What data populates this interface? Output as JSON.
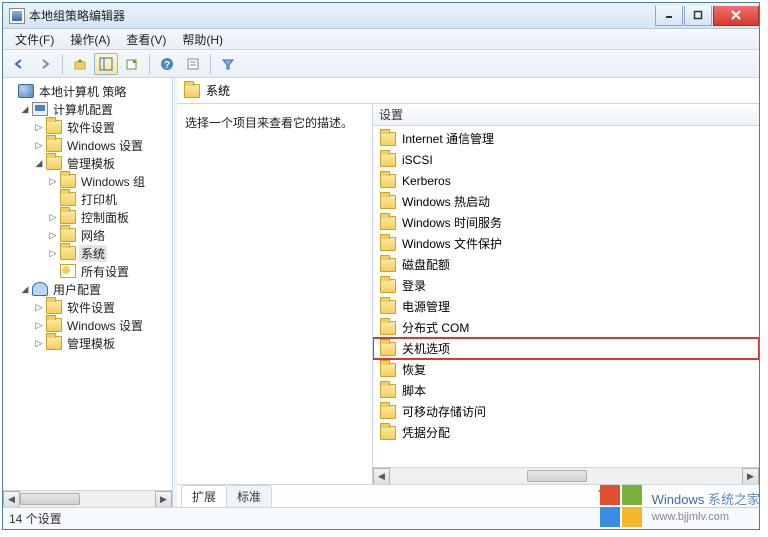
{
  "window": {
    "title": "本地组策略编辑器"
  },
  "menu": {
    "file": "文件(F)",
    "action": "操作(A)",
    "view": "查看(V)",
    "help": "帮助(H)"
  },
  "tree": {
    "root": "本地计算机 策略",
    "computer_config": "计算机配置",
    "software_settings": "软件设置",
    "windows_settings": "Windows 设置",
    "admin_templates": "管理模板",
    "windows_components": "Windows 组",
    "printers": "打印机",
    "control_panel": "控制面板",
    "network": "网络",
    "system": "系统",
    "all_settings": "所有设置",
    "user_config": "用户配置",
    "software_settings2": "软件设置",
    "windows_settings2": "Windows 设置",
    "admin_templates2": "管理模板"
  },
  "header": {
    "path": "系统"
  },
  "desc": {
    "text": "选择一个项目来查看它的描述。"
  },
  "colhead": {
    "settings": "设置"
  },
  "items": [
    {
      "label": "Internet 通信管理"
    },
    {
      "label": "iSCSI"
    },
    {
      "label": "Kerberos"
    },
    {
      "label": "Windows 热启动"
    },
    {
      "label": "Windows 时间服务"
    },
    {
      "label": "Windows 文件保护"
    },
    {
      "label": "磁盘配额"
    },
    {
      "label": "登录"
    },
    {
      "label": "电源管理"
    },
    {
      "label": "分布式 COM"
    },
    {
      "label": "关机选项",
      "highlight": true
    },
    {
      "label": "恢复"
    },
    {
      "label": "脚本"
    },
    {
      "label": "可移动存储访问"
    },
    {
      "label": "凭据分配"
    }
  ],
  "tabs": {
    "extended": "扩展",
    "standard": "标准"
  },
  "status": {
    "text": "14 个设置"
  },
  "watermark": {
    "brand": "Windows",
    "suffix": "系统之家",
    "url": "www.bjjmlv.com"
  }
}
